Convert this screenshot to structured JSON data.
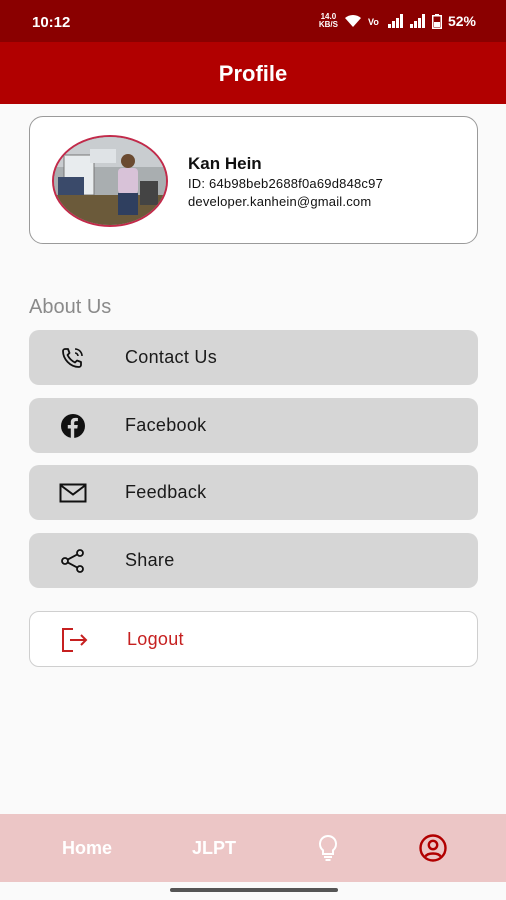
{
  "status_bar": {
    "time": "10:12",
    "net_speed_value": "14.0",
    "net_speed_unit": "KB/S",
    "battery": "52%"
  },
  "app_bar": {
    "title": "Profile"
  },
  "profile": {
    "name": "Kan Hein",
    "id": "ID: 64b98beb2688f0a69d848c97",
    "email": "developer.kanhein@gmail.com"
  },
  "about": {
    "title": "About Us",
    "items": [
      {
        "label": "Contact Us",
        "icon": "phone-call-icon"
      },
      {
        "label": "Facebook",
        "icon": "facebook-icon"
      },
      {
        "label": "Feedback",
        "icon": "mail-icon"
      },
      {
        "label": "Share",
        "icon": "share-icon"
      }
    ]
  },
  "logout": {
    "label": "Logout",
    "icon": "logout-icon",
    "color": "#c62020"
  },
  "bottom_nav": {
    "items": [
      {
        "label": "Home"
      },
      {
        "label": "JLPT"
      },
      {
        "label": "",
        "icon": "lightbulb-icon"
      },
      {
        "label": "",
        "icon": "profile-circle-icon",
        "active": true
      }
    ]
  },
  "colors": {
    "status_bar": "#8a0000",
    "app_bar": "#b10000",
    "bottom_nav": "#ecc6c6",
    "menu_bg": "#d6d6d6",
    "accent": "#b10000"
  }
}
